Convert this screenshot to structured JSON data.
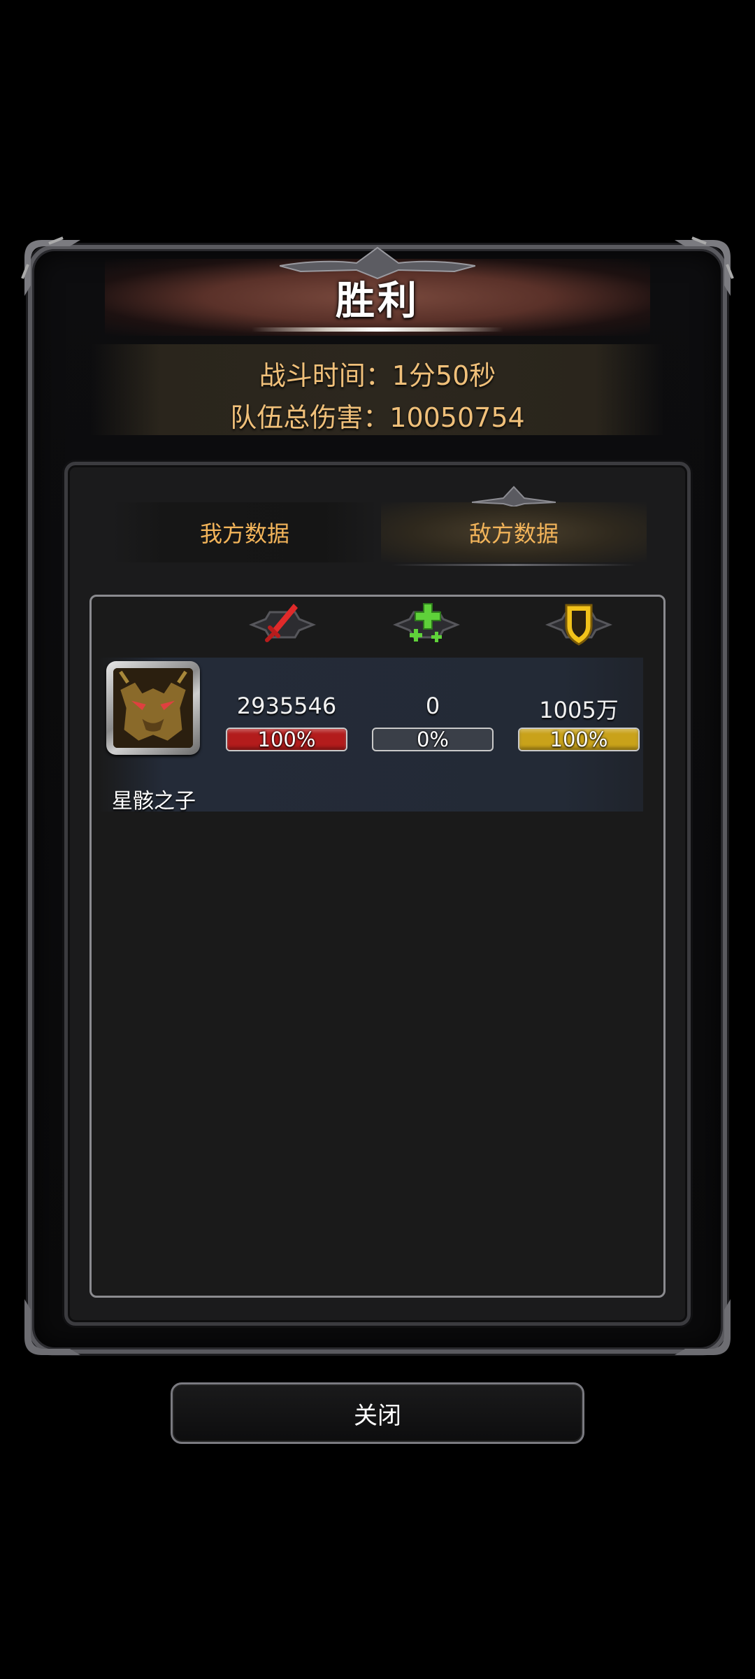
{
  "title": "胜利",
  "battle_info": {
    "time_line": "战斗时间：1分50秒",
    "damage_line": "队伍总伤害：10050754"
  },
  "tabs": [
    {
      "label": "我方数据",
      "active": false
    },
    {
      "label": "敌方数据",
      "active": true
    }
  ],
  "columns": [
    {
      "icon": "sword-icon",
      "color": "#e02a2a"
    },
    {
      "icon": "heal-cross-icon",
      "color": "#5fd13a"
    },
    {
      "icon": "shield-icon",
      "color": "#f2c21a"
    }
  ],
  "units": [
    {
      "name": "星骸之子",
      "portrait": "dragon-portrait",
      "stats": [
        {
          "value": "2935546",
          "percent_label": "100%",
          "fill": 1.0,
          "color": "#b31c1c"
        },
        {
          "value": "0",
          "percent_label": "0%",
          "fill": 0.0,
          "color": "#7a7f88"
        },
        {
          "value": "1005万",
          "percent_label": "100%",
          "fill": 1.0,
          "color": "#c9a21a"
        }
      ]
    }
  ],
  "close_label": "关闭"
}
